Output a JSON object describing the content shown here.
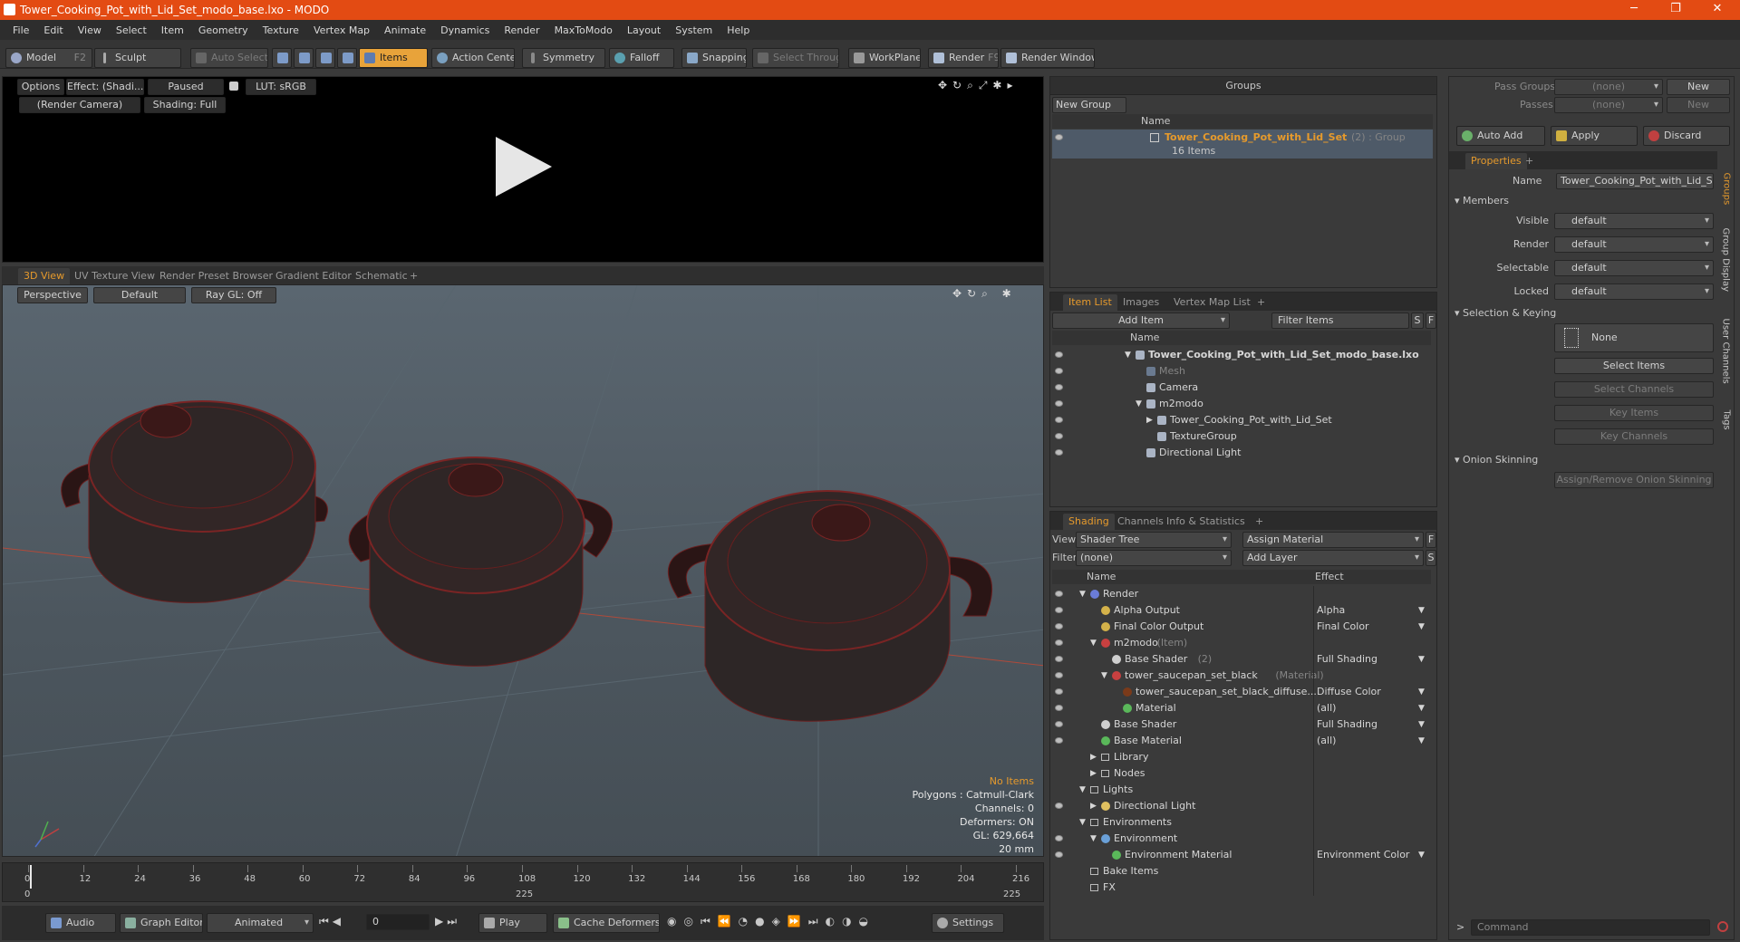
{
  "window": {
    "title": "Tower_Cooking_Pot_with_Lid_Set_modo_base.lxo - MODO",
    "controls": [
      "─",
      "❐",
      "✕"
    ]
  },
  "menu": [
    "File",
    "Edit",
    "View",
    "Select",
    "Item",
    "Geometry",
    "Texture",
    "Vertex Map",
    "Animate",
    "Dynamics",
    "Render",
    "MaxToModo",
    "Layout",
    "System",
    "Help"
  ],
  "toolbar": {
    "model": "Model",
    "model_key": "F2",
    "sculpt": "Sculpt",
    "auto_select": "Auto Select",
    "items": "Items",
    "action_center": "Action Center",
    "symmetry": "Symmetry",
    "falloff": "Falloff",
    "snapping": "Snapping",
    "select_through": "Select Through",
    "workplane": "WorkPlane",
    "render": "Render",
    "render_key": "F9",
    "render_window": "Render Window"
  },
  "preview": {
    "options": "Options",
    "effect": "Effect: (Shadi...",
    "paused": "Paused",
    "lut": "LUT: sRGB",
    "camera": "(Render Camera)",
    "shading": "Shading: Full"
  },
  "viewtabs": [
    "3D View",
    "UV Texture View",
    "Render Preset Browser",
    "Gradient Editor",
    "Schematic",
    "+"
  ],
  "viewport": {
    "perspective": "Perspective",
    "default": "Default",
    "raygl": "Ray GL: Off",
    "stats": {
      "noitems": "No Items",
      "polygons": "Polygons : Catmull-Clark",
      "channels": "Channels: 0",
      "deformers": "Deformers: ON",
      "gl": "GL: 629,664",
      "size": "20 mm"
    }
  },
  "timeline": {
    "ticks": [
      "0",
      "12",
      "24",
      "36",
      "48",
      "60",
      "72",
      "84",
      "96",
      "108",
      "120",
      "132",
      "144",
      "156",
      "168",
      "180",
      "192",
      "204",
      "216"
    ],
    "start": "0",
    "mid": "225",
    "end": "225"
  },
  "bottombar": {
    "audio": "Audio",
    "graph_editor": "Graph Editor",
    "animated": "Animated",
    "frame": "0",
    "play": "Play",
    "cache": "Cache Deformers",
    "settings": "Settings"
  },
  "groups": {
    "title": "Groups",
    "new_group": "New Group",
    "col_name": "Name",
    "item_name": "Tower_Cooking_Pot_with_Lid_Set",
    "item_count": "(2) : Group",
    "item_sub": "16 Items"
  },
  "itemlist": {
    "tabs": [
      "Item List",
      "Images",
      "Vertex Map List",
      "+"
    ],
    "add_item": "Add Item",
    "filter": "Filter Items",
    "s": "S",
    "f": "F",
    "col_name": "Name",
    "rows": [
      {
        "label": "Tower_Cooking_Pot_with_Lid_Set_modo_base.lxo",
        "indent": 0,
        "bold": true,
        "gray": false,
        "arrow": "▼"
      },
      {
        "label": "Mesh",
        "indent": 1,
        "bold": false,
        "gray": true,
        "arrow": ""
      },
      {
        "label": "Camera",
        "indent": 1,
        "bold": false,
        "gray": false,
        "arrow": ""
      },
      {
        "label": "m2modo",
        "indent": 1,
        "bold": false,
        "gray": false,
        "arrow": "▼"
      },
      {
        "label": "Tower_Cooking_Pot_with_Lid_Set",
        "indent": 2,
        "bold": false,
        "gray": false,
        "arrow": "▶"
      },
      {
        "label": "TextureGroup",
        "indent": 2,
        "bold": false,
        "gray": false,
        "arrow": ""
      },
      {
        "label": "Directional Light",
        "indent": 1,
        "bold": false,
        "gray": false,
        "arrow": ""
      }
    ]
  },
  "shading": {
    "tabs": [
      "Shading",
      "Channels",
      "Info & Statistics",
      "+"
    ],
    "view_label": "View",
    "view_value": "Shader Tree",
    "assign": "Assign Material",
    "filter_label": "Filter",
    "filter_value": "(none)",
    "add_layer": "Add Layer",
    "f": "F",
    "s": "S",
    "col_name": "Name",
    "col_effect": "Effect",
    "rows": [
      {
        "name": "Render",
        "tag": "",
        "effect": "",
        "indent": 0,
        "arrow": "▼",
        "color": "#6a7cd8"
      },
      {
        "name": "Alpha Output",
        "tag": "",
        "effect": "Alpha",
        "indent": 1,
        "arrow": "",
        "color": "#d4b24a"
      },
      {
        "name": "Final Color Output",
        "tag": "",
        "effect": "Final Color",
        "indent": 1,
        "arrow": "",
        "color": "#d4b24a"
      },
      {
        "name": "m2modo",
        "tag": "(Item)",
        "effect": "",
        "indent": 1,
        "arrow": "▼",
        "color": "#c84040"
      },
      {
        "name": "Base Shader",
        "tag": "(2)",
        "effect": "Full Shading",
        "indent": 2,
        "arrow": "",
        "color": "#cfcfcf"
      },
      {
        "name": "tower_saucepan_set_black",
        "tag": "(Material)",
        "effect": "",
        "indent": 2,
        "arrow": "▼",
        "color": "#c84040"
      },
      {
        "name": "tower_saucepan_set_black_diffuse...",
        "tag": "",
        "effect": "Diffuse Color",
        "indent": 3,
        "arrow": "",
        "color": "#7a3a1a"
      },
      {
        "name": "Material",
        "tag": "",
        "effect": "(all)",
        "indent": 3,
        "arrow": "",
        "color": "#5ab85a"
      },
      {
        "name": "Base Shader",
        "tag": "",
        "effect": "Full Shading",
        "indent": 1,
        "arrow": "",
        "color": "#cfcfcf"
      },
      {
        "name": "Base Material",
        "tag": "",
        "effect": "(all)",
        "indent": 1,
        "arrow": "",
        "color": "#5ab85a"
      },
      {
        "name": "Library",
        "tag": "",
        "effect": "",
        "indent": 1,
        "arrow": "▶",
        "color": ""
      },
      {
        "name": "Nodes",
        "tag": "",
        "effect": "",
        "indent": 1,
        "arrow": "▶",
        "color": ""
      },
      {
        "name": "Lights",
        "tag": "",
        "effect": "",
        "indent": 0,
        "arrow": "▼",
        "color": ""
      },
      {
        "name": "Directional Light",
        "tag": "",
        "effect": "",
        "indent": 1,
        "arrow": "▶",
        "color": "#e0c060"
      },
      {
        "name": "Environments",
        "tag": "",
        "effect": "",
        "indent": 0,
        "arrow": "▼",
        "color": ""
      },
      {
        "name": "Environment",
        "tag": "",
        "effect": "",
        "indent": 1,
        "arrow": "▼",
        "color": "#6aa0d8"
      },
      {
        "name": "Environment Material",
        "tag": "",
        "effect": "Environment Color",
        "indent": 2,
        "arrow": "",
        "color": "#5ab85a"
      },
      {
        "name": "Bake Items",
        "tag": "",
        "effect": "",
        "indent": 0,
        "arrow": "",
        "color": ""
      },
      {
        "name": "FX",
        "tag": "",
        "effect": "",
        "indent": 0,
        "arrow": "",
        "color": ""
      }
    ]
  },
  "rightpanel": {
    "pass_groups": "Pass Groups",
    "passes": "Passes",
    "none1": "(none)",
    "none2": "(none)",
    "new1": "New",
    "new2": "New",
    "auto_add": "Auto Add",
    "apply": "Apply",
    "discard": "Discard",
    "properties": "Properties",
    "name_label": "Name",
    "name_value": "Tower_Cooking_Pot_with_Lid_Set",
    "members": "Members",
    "fields": [
      {
        "label": "Visible",
        "value": "default"
      },
      {
        "label": "Render",
        "value": "default"
      },
      {
        "label": "Selectable",
        "value": "default"
      },
      {
        "label": "Locked",
        "value": "default"
      }
    ],
    "sel_keying": "Selection & Keying",
    "none": "None",
    "select_items": "Select Items",
    "select_channels": "Select Channels",
    "key_items": "Key Items",
    "key_channels": "Key Channels",
    "onion": "Onion Skinning",
    "assign_onion": "Assign/Remove Onion Skinning",
    "sidetabs": [
      "Groups",
      "Group Display",
      "User Channels",
      "Tags"
    ],
    "command": "Command"
  },
  "colors": {
    "accent": "#e69a2c",
    "title": "#e34b13"
  }
}
